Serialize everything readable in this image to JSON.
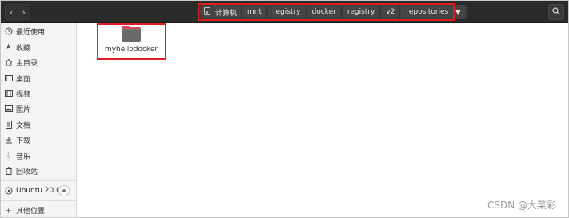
{
  "header": {
    "back_glyph": "‹",
    "forward_glyph": "›",
    "path": [
      "计算机",
      "mnt",
      "registry",
      "docker",
      "registry",
      "v2",
      "repositories"
    ],
    "dropdown_glyph": "▼"
  },
  "sidebar": {
    "items": [
      {
        "label": "最近使用",
        "icon": "clock-icon"
      },
      {
        "label": "收藏",
        "icon": "star-icon"
      },
      {
        "label": "主目录",
        "icon": "home-icon"
      },
      {
        "label": "桌面",
        "icon": "desktop-icon"
      },
      {
        "label": "视频",
        "icon": "video-icon"
      },
      {
        "label": "图片",
        "icon": "image-icon"
      },
      {
        "label": "文档",
        "icon": "document-icon"
      },
      {
        "label": "下载",
        "icon": "download-icon"
      },
      {
        "label": "音乐",
        "icon": "music-icon"
      },
      {
        "label": "回收站",
        "icon": "trash-icon"
      }
    ],
    "device": {
      "label": "Ubuntu 20.0...",
      "icon": "disc-icon"
    },
    "other_locations": {
      "label": "其他位置",
      "icon": "plus-icon"
    }
  },
  "main": {
    "folder": {
      "name": "myhellodocker",
      "icon": "folder-icon"
    }
  },
  "watermark": "CSDN @大菜彩",
  "colors": {
    "header_bg": "#2b2b2b",
    "folder": "#6a6a6a",
    "folder_tab": "#d24a59",
    "highlight": "#e11d24"
  }
}
